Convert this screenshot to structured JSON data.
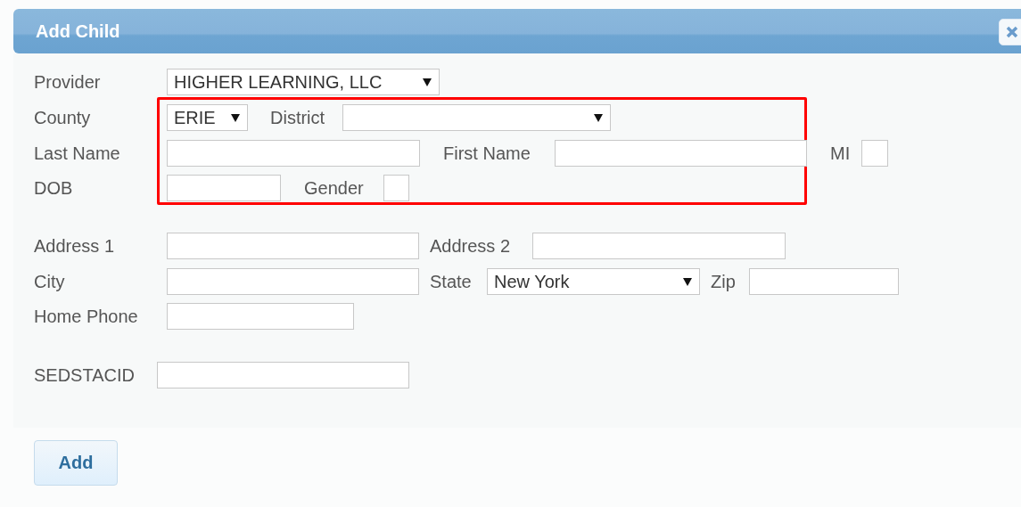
{
  "dialog": {
    "title": "Add Child"
  },
  "form_rows": [
    [
      {
        "kind": "label",
        "text": "Provider"
      },
      {
        "kind": "select",
        "value": "HIGHER LEARNING, LLC"
      }
    ],
    [
      {
        "kind": "label",
        "text": "County"
      },
      {
        "kind": "select",
        "value": "ERIE"
      },
      {
        "kind": "label",
        "text": "District"
      },
      {
        "kind": "select"
      }
    ],
    [
      {
        "kind": "label",
        "text": "Last Name"
      },
      {
        "kind": "input"
      },
      {
        "kind": "label",
        "text": "First Name"
      },
      {
        "kind": "input"
      },
      {
        "kind": "label",
        "text": "MI"
      },
      {
        "kind": "input"
      }
    ],
    [
      {
        "kind": "label",
        "text": "DOB"
      },
      {
        "kind": "input"
      },
      {
        "kind": "label",
        "text": "Gender"
      },
      {
        "kind": "input"
      }
    ],
    [
      {
        "kind": "label",
        "text": "Address 1"
      },
      {
        "kind": "input"
      },
      {
        "kind": "label",
        "text": "Address 2"
      },
      {
        "kind": "input"
      }
    ],
    [
      {
        "kind": "label",
        "text": "City"
      },
      {
        "kind": "input"
      },
      {
        "kind": "label",
        "text": "State"
      },
      {
        "kind": "select",
        "value": "New York"
      },
      {
        "kind": "label",
        "text": "Zip"
      },
      {
        "kind": "input"
      }
    ],
    [
      {
        "kind": "label",
        "text": "Home Phone"
      },
      {
        "kind": "input"
      }
    ],
    [
      {
        "kind": "label",
        "text": "SEDSTACID"
      },
      {
        "kind": "input"
      }
    ]
  ],
  "buttons": [
    {
      "label": "Add"
    }
  ]
}
